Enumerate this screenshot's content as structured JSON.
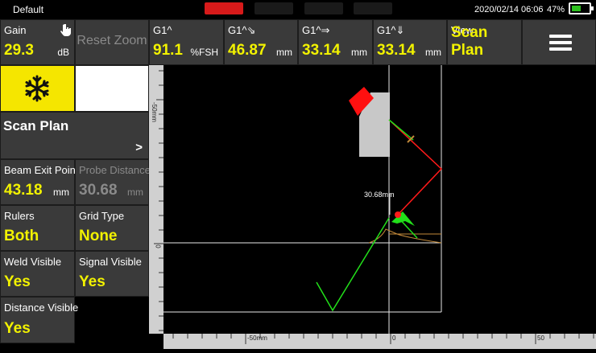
{
  "status_bar": {
    "profile": "Default",
    "date": "2020/02/14",
    "time": "06:06",
    "battery_percent": "47%",
    "battery_level": 0.47,
    "indicator_colors": [
      "#d71a1a",
      "#1a1a1a",
      "#1a1a1a",
      "#1a1a1a"
    ]
  },
  "top_row": {
    "gain": {
      "label": "Gain",
      "value": "29.3",
      "unit": "dB"
    },
    "reset_zoom": "Reset Zoom",
    "readings": [
      {
        "label": "G1^",
        "value": "91.1",
        "unit": "%FSH"
      },
      {
        "label": "G1^⇘",
        "value": "46.87",
        "unit": "mm"
      },
      {
        "label": "G1^⇒",
        "value": "33.14",
        "unit": "mm"
      },
      {
        "label": "G1^⇓",
        "value": "33.14",
        "unit": "mm"
      }
    ],
    "view": {
      "label": "View",
      "value": "Scan Plan"
    }
  },
  "sidebar": {
    "freeze_icon": "snowflake-icon",
    "scan_plan": {
      "title": "Scan Plan",
      "arrow": ">"
    },
    "params": [
      {
        "label": "Beam Exit Point",
        "value": "43.18",
        "unit": "mm",
        "enabled": true
      },
      {
        "label": "Probe Distance",
        "value": "30.68",
        "unit": "mm",
        "enabled": false
      },
      {
        "label": "Rulers",
        "value": "Both"
      },
      {
        "label": "Grid Type",
        "value": "None"
      },
      {
        "label": "Weld Visible",
        "value": "Yes"
      },
      {
        "label": "Signal Visible",
        "value": "Yes"
      },
      {
        "label": "Distance Visible",
        "value": "Yes"
      }
    ]
  },
  "plot": {
    "distance_label": "30.68mm",
    "left_ruler_labels": [
      "-50mm",
      "0"
    ],
    "bottom_ruler_labels": [
      "-50mm",
      "0",
      "50"
    ],
    "colors": {
      "accent": "#f2f200",
      "beam_red": "#ff1a1a",
      "beam_green": "#22e01a",
      "probe": "#c8c8c8"
    }
  }
}
